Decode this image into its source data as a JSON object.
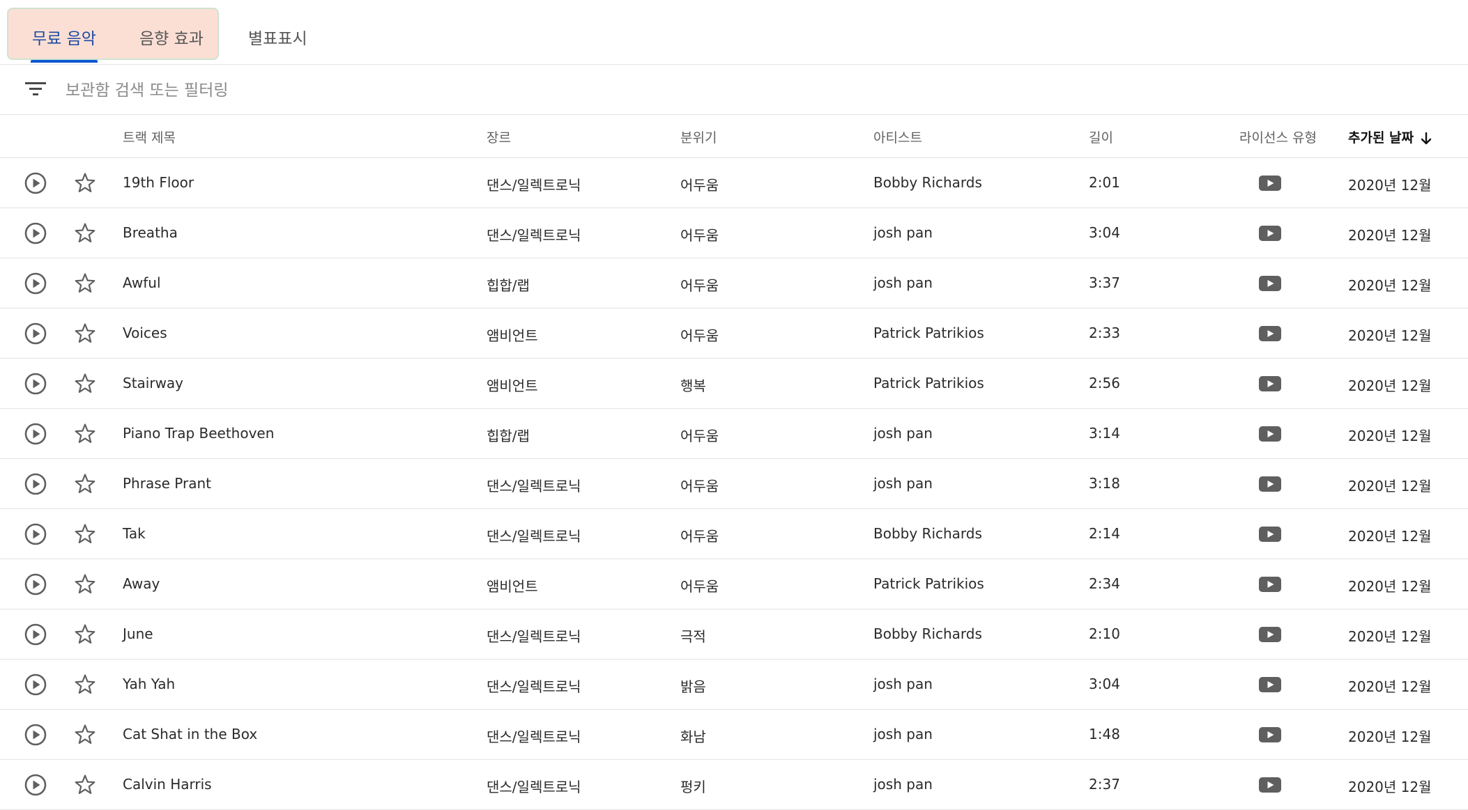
{
  "tabs": [
    {
      "label": "무료 음악",
      "active": true
    },
    {
      "label": "음향 효과",
      "active": false
    },
    {
      "label": "별표표시",
      "active": false
    }
  ],
  "search": {
    "placeholder": "보관함 검색 또는 필터링",
    "value": ""
  },
  "table": {
    "columns": {
      "title": "트랙 제목",
      "genre": "장르",
      "mood": "분위기",
      "artist": "아티스트",
      "length": "길이",
      "license": "라이선스 유형",
      "added": "추가된 날짜"
    },
    "sorted_by": "added",
    "sort_direction": "descending",
    "rows": [
      {
        "title": "19th Floor",
        "genre": "댄스/일렉트로닉",
        "mood": "어두움",
        "artist": "Bobby Richards",
        "length": "2:01",
        "license_icon": "youtube-icon",
        "added": "2020년 12월"
      },
      {
        "title": "Breatha",
        "genre": "댄스/일렉트로닉",
        "mood": "어두움",
        "artist": "josh pan",
        "length": "3:04",
        "license_icon": "youtube-icon",
        "added": "2020년 12월"
      },
      {
        "title": "Awful",
        "genre": "힙합/랩",
        "mood": "어두움",
        "artist": "josh pan",
        "length": "3:37",
        "license_icon": "youtube-icon",
        "added": "2020년 12월"
      },
      {
        "title": "Voices",
        "genre": "앰비언트",
        "mood": "어두움",
        "artist": "Patrick Patrikios",
        "length": "2:33",
        "license_icon": "youtube-icon",
        "added": "2020년 12월"
      },
      {
        "title": "Stairway",
        "genre": "앰비언트",
        "mood": "행복",
        "artist": "Patrick Patrikios",
        "length": "2:56",
        "license_icon": "youtube-icon",
        "added": "2020년 12월"
      },
      {
        "title": "Piano Trap Beethoven",
        "genre": "힙합/랩",
        "mood": "어두움",
        "artist": "josh pan",
        "length": "3:14",
        "license_icon": "youtube-icon",
        "added": "2020년 12월"
      },
      {
        "title": "Phrase Prant",
        "genre": "댄스/일렉트로닉",
        "mood": "어두움",
        "artist": "josh pan",
        "length": "3:18",
        "license_icon": "youtube-icon",
        "added": "2020년 12월"
      },
      {
        "title": "Tak",
        "genre": "댄스/일렉트로닉",
        "mood": "어두움",
        "artist": "Bobby Richards",
        "length": "2:14",
        "license_icon": "youtube-icon",
        "added": "2020년 12월"
      },
      {
        "title": "Away",
        "genre": "앰비언트",
        "mood": "어두움",
        "artist": "Patrick Patrikios",
        "length": "2:34",
        "license_icon": "youtube-icon",
        "added": "2020년 12월"
      },
      {
        "title": "June",
        "genre": "댄스/일렉트로닉",
        "mood": "극적",
        "artist": "Bobby Richards",
        "length": "2:10",
        "license_icon": "youtube-icon",
        "added": "2020년 12월"
      },
      {
        "title": "Yah Yah",
        "genre": "댄스/일렉트로닉",
        "mood": "밝음",
        "artist": "josh pan",
        "length": "3:04",
        "license_icon": "youtube-icon",
        "added": "2020년 12월"
      },
      {
        "title": "Cat Shat in the Box",
        "genre": "댄스/일렉트로닉",
        "mood": "화남",
        "artist": "josh pan",
        "length": "1:48",
        "license_icon": "youtube-icon",
        "added": "2020년 12월"
      },
      {
        "title": "Calvin Harris",
        "genre": "댄스/일렉트로닉",
        "mood": "펑키",
        "artist": "josh pan",
        "length": "2:37",
        "license_icon": "youtube-icon",
        "added": "2020년 12월"
      }
    ]
  },
  "colors": {
    "active_tab_text": "#1b4aa0",
    "active_tab_underline": "#0b57d0",
    "tab_highlight_bg": "#fbdfd5",
    "tab_highlight_border": "#cfe3cf",
    "divider": "#e3e3e3",
    "icon_grey": "#5f5f5f"
  }
}
